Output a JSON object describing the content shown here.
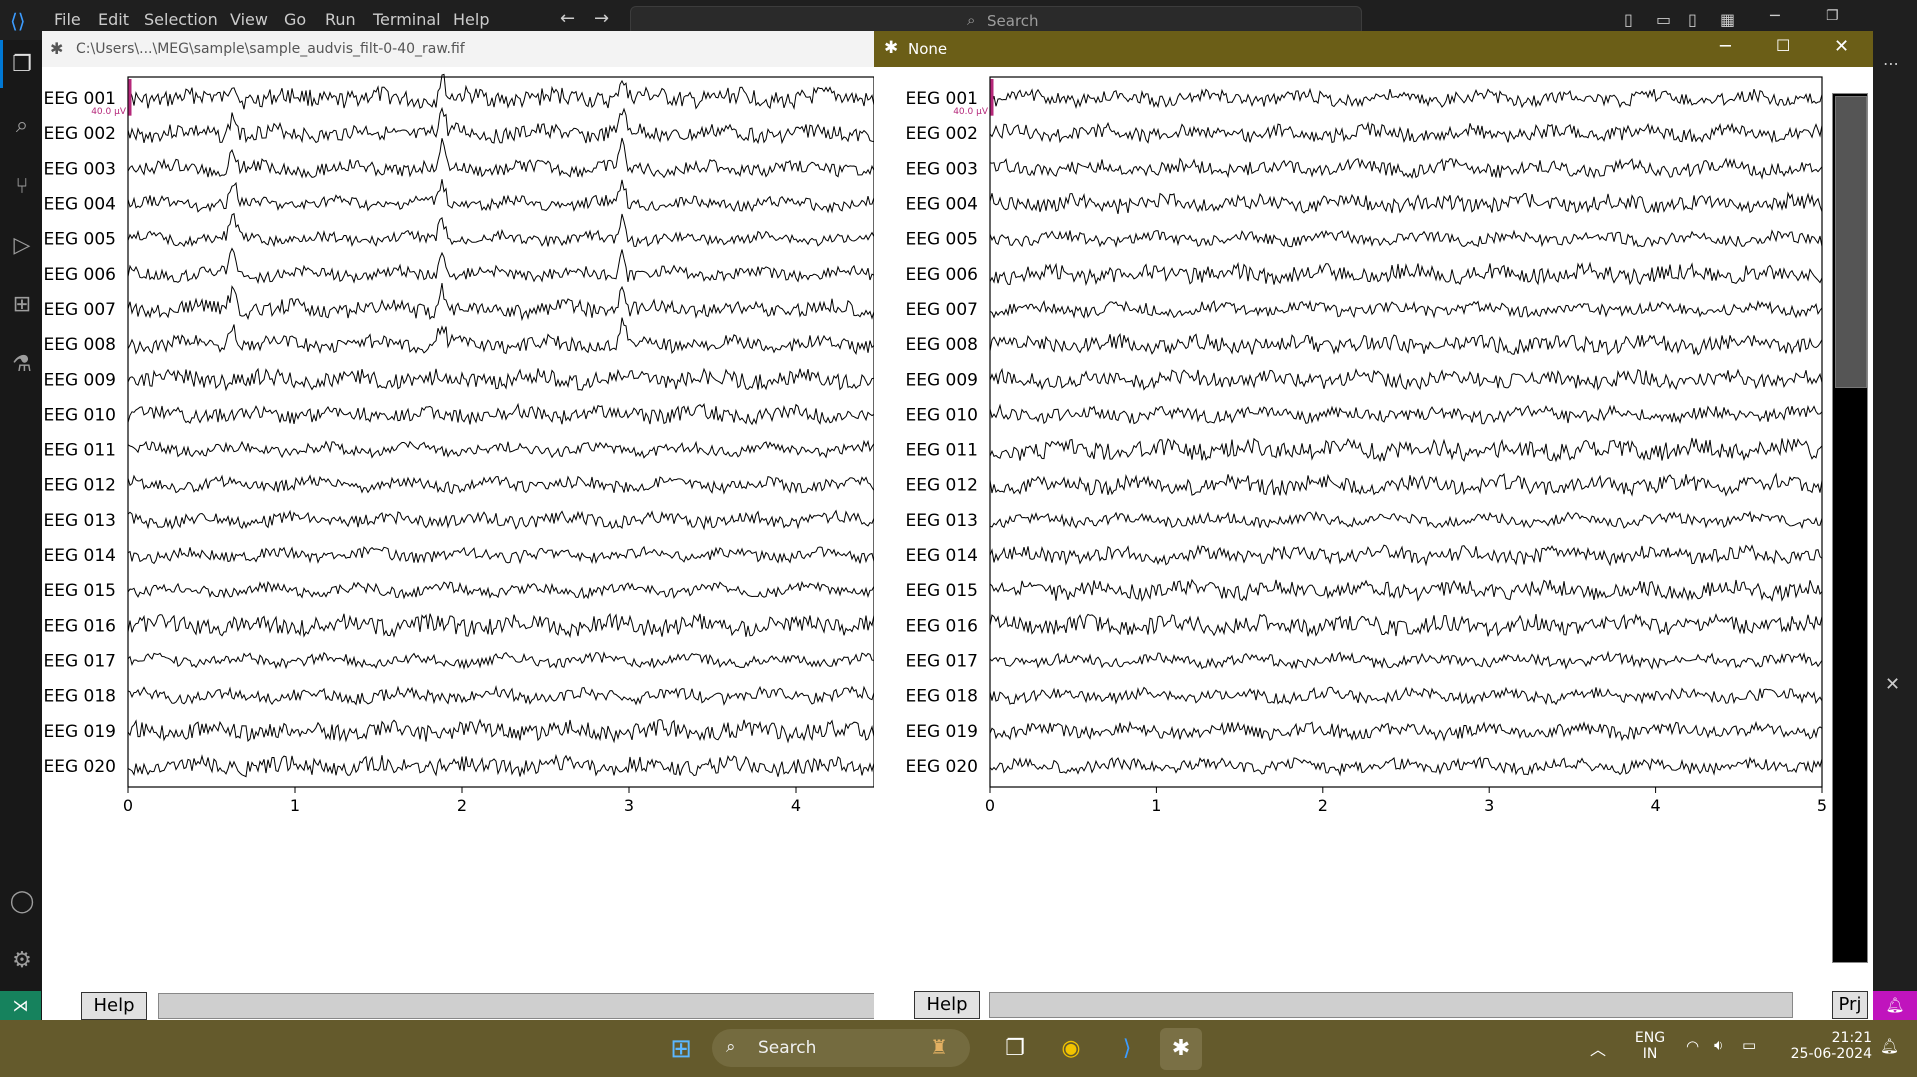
{
  "vscode": {
    "menu": [
      "File",
      "Edit",
      "Selection",
      "View",
      "Go",
      "Run",
      "Terminal",
      "Help"
    ],
    "search_label": "Search"
  },
  "window_left": {
    "title": "C:\\Users\\...\\MEG\\sample\\sample_audvis_filt-0-40_raw.fif",
    "help_label": "Help",
    "scale_label": "40.0 µV"
  },
  "window_right": {
    "title": "None",
    "help_label": "Help",
    "proj_label": "Prj",
    "scale_label": "40.0 µV"
  },
  "channels": [
    "EEG 001",
    "EEG 002",
    "EEG 003",
    "EEG 004",
    "EEG 005",
    "EEG 006",
    "EEG 007",
    "EEG 008",
    "EEG 009",
    "EEG 010",
    "EEG 011",
    "EEG 012",
    "EEG 013",
    "EEG 014",
    "EEG 015",
    "EEG 016",
    "EEG 017",
    "EEG 018",
    "EEG 019",
    "EEG 020"
  ],
  "x_ticks_left": [
    "0",
    "1",
    "2",
    "3",
    "4"
  ],
  "x_ticks_right": [
    "0",
    "1",
    "2",
    "3",
    "4",
    "5"
  ],
  "taskbar": {
    "search_label": "Search",
    "lang_top": "ENG",
    "lang_bottom": "IN",
    "time": "21:21",
    "date": "25-06-2024"
  },
  "colors": {
    "right_titlebar": "#6b5e17",
    "scale_marker": "#b5287a",
    "taskbar": "#645a2c"
  }
}
